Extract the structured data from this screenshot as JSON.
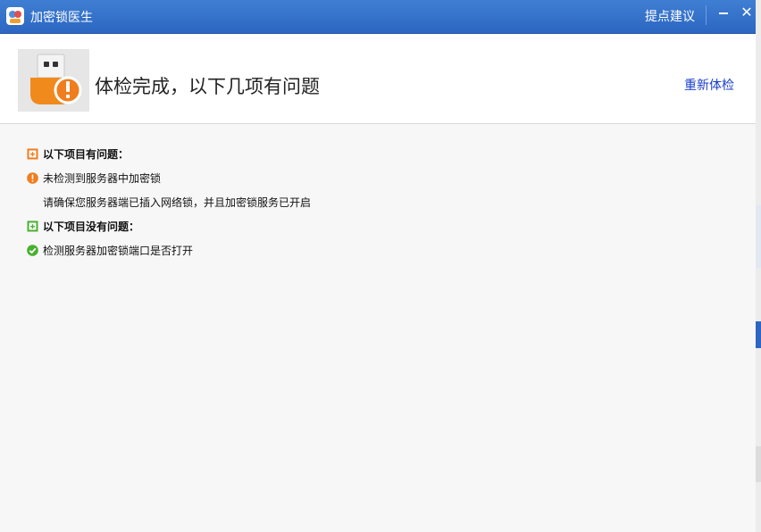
{
  "window": {
    "title": "加密锁医生",
    "feedback": "提点建议"
  },
  "header": {
    "title": "体检完成，以下几项有问题",
    "recheck": "重新体检"
  },
  "problems": {
    "heading": "以下项目有问题：",
    "items": [
      {
        "text": "未检测到服务器中加密锁",
        "hint": "请确保您服务器端已插入网络锁，并且加密锁服务已开启"
      }
    ]
  },
  "ok": {
    "heading": "以下项目没有问题：",
    "items": [
      {
        "text": "检测服务器加密锁端口是否打开"
      }
    ]
  },
  "colors": {
    "titlebar": "#2c66c1",
    "warning": "#f07d1e",
    "ok": "#48b030",
    "link": "#1a3ec9"
  }
}
